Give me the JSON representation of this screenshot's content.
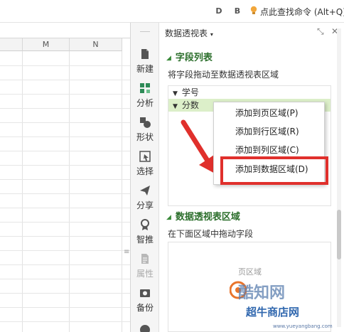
{
  "topbar": {
    "icon1": "D",
    "icon2": "B",
    "search_label": "点此查找命令 (Alt+Q)"
  },
  "sheet": {
    "columns": [
      "",
      "M",
      "N"
    ]
  },
  "toolstrip": {
    "items": [
      {
        "label": "新建",
        "icon": "new-icon"
      },
      {
        "label": "分析",
        "icon": "analyze-icon"
      },
      {
        "label": "形状",
        "icon": "shape-icon"
      },
      {
        "label": "选择",
        "icon": "select-icon"
      },
      {
        "label": "分享",
        "icon": "share-icon"
      },
      {
        "label": "智推",
        "icon": "smart-push-icon"
      },
      {
        "label": "属性",
        "icon": "properties-icon"
      },
      {
        "label": "备份",
        "icon": "backup-icon"
      }
    ]
  },
  "pane": {
    "title": "数据透视表",
    "field_section": "字段列表",
    "field_hint": "将字段拖动至数据透视表区域",
    "fields": [
      "学号",
      "分数"
    ],
    "area_section": "数据透视表区域",
    "area_hint": "在下面区域中拖动字段",
    "page_area_label": "页区域"
  },
  "context_menu": {
    "items": [
      "添加到页区域(P)",
      "添加到行区域(R)",
      "添加到列区域(C)",
      "添加到数据区域(D)"
    ]
  },
  "watermarks": {
    "brand": "酷知网",
    "site": "超牛商店网",
    "url": "www.yueyangbang.com"
  },
  "colors": {
    "accent_green": "#2b6e2b",
    "selection_green": "#dcefc9",
    "highlight_red": "#e0302c"
  }
}
